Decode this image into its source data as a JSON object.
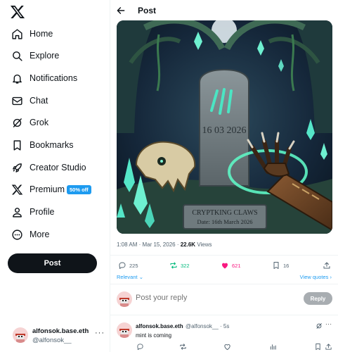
{
  "sidebar": {
    "logo": "x-logo-icon",
    "items": [
      {
        "label": "Home",
        "icon": "home-icon"
      },
      {
        "label": "Explore",
        "icon": "search-icon"
      },
      {
        "label": "Notifications",
        "icon": "bell-icon"
      },
      {
        "label": "Chat",
        "icon": "envelope-icon"
      },
      {
        "label": "Grok",
        "icon": "grok-icon"
      },
      {
        "label": "Bookmarks",
        "icon": "bookmark-icon"
      },
      {
        "label": "Creator Studio",
        "icon": "rocket-icon"
      },
      {
        "label": "Premium",
        "icon": "x-logo-icon",
        "badge": "50% off"
      },
      {
        "label": "Profile",
        "icon": "person-icon"
      },
      {
        "label": "More",
        "icon": "more-circle-icon"
      }
    ],
    "post_label": "Post",
    "account": {
      "name": "alfonsok.base.eth",
      "handle": "@alfonsok__",
      "more": "···"
    }
  },
  "header": {
    "title": "Post"
  },
  "post": {
    "image": {
      "date_text": "16 03 2026",
      "banner_line1": "CRYPTKING CLAWS",
      "banner_line2": "Date: 16th March 2026"
    },
    "time": "1:08 AM · Mar 15, 2026 · ",
    "views_count": "22.6K",
    "views_label": "Views",
    "stats": {
      "replies": "225",
      "reposts": "322",
      "likes": "621",
      "bookmarks": "16"
    },
    "relevant_label": "Relevant",
    "view_quotes_label": "View quotes"
  },
  "reply_box": {
    "placeholder": "Post your reply",
    "button": "Reply"
  },
  "comment": {
    "name": "alfonsok.base.eth",
    "handle": "@alfonsok__ · 5s",
    "text": "mint is coming"
  },
  "colors": {
    "accent": "#1d9bf0",
    "repost": "#00ba7c",
    "like": "#f91880",
    "text": "#0f1419",
    "muted": "#536471"
  }
}
